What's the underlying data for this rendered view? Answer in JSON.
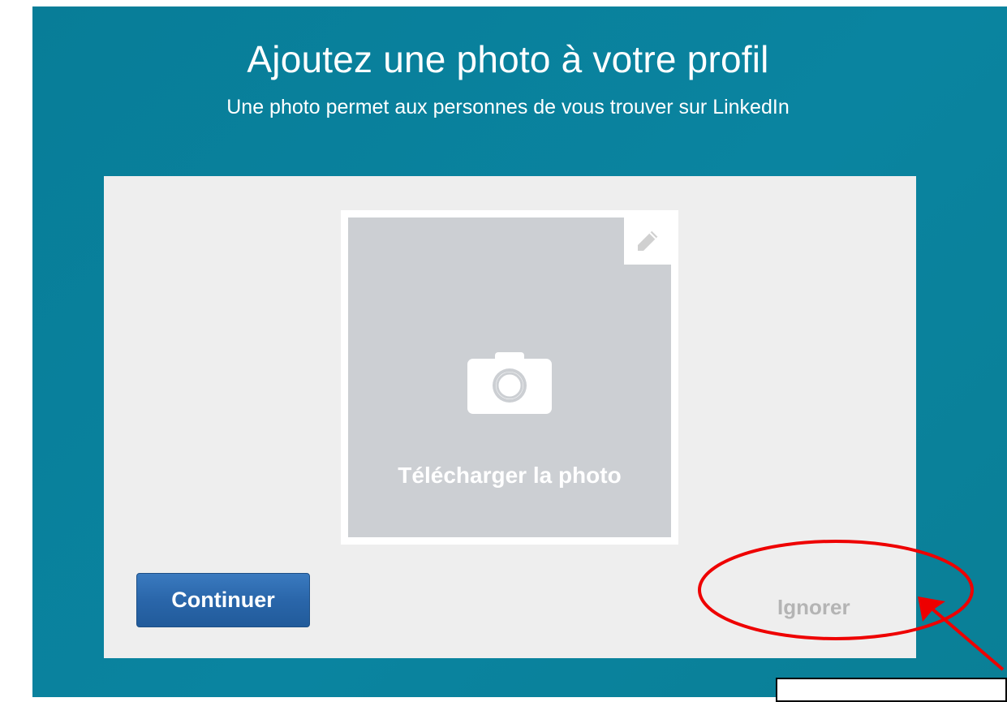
{
  "dialog": {
    "title": "Ajoutez une photo à votre profil",
    "subtitle": "Une photo permet aux personnes de vous trouver sur LinkedIn"
  },
  "photo": {
    "upload_label": "Télécharger la photo",
    "camera_icon": "camera-icon",
    "edit_icon": "pencil-icon"
  },
  "actions": {
    "continue_label": "Continuer",
    "ignore_label": "Ignorer"
  },
  "colors": {
    "background": "#0a84a0",
    "card": "#eeeeee",
    "photo_placeholder": "#cccfd3",
    "primary_button": "#2a66aa",
    "annotation": "#ee0000"
  }
}
